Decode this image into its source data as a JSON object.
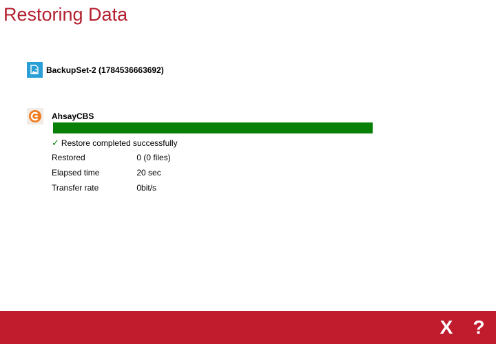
{
  "page": {
    "title": "Restoring Data"
  },
  "backup_set": {
    "name": "BackupSet-2 (1784536663692)",
    "icon": "backup-set-icon"
  },
  "destination": {
    "name": "AhsayCBS",
    "icon": "ahsay-cbs-icon",
    "progress_fraction": 1.0,
    "status": "Restore completed successfully",
    "stats": [
      {
        "label": "Restored",
        "value": "0 (0 files)"
      },
      {
        "label": "Elapsed time",
        "value": "20 sec"
      },
      {
        "label": "Transfer rate",
        "value": "0bit/s"
      }
    ]
  },
  "footer": {
    "close_label": "X",
    "help_label": "?"
  },
  "colors": {
    "accent": "#c01c2d",
    "title": "#b3202f",
    "progress": "#088008",
    "backup_icon_bg": "#2a9fd6",
    "cbs_icon": "#f07c22"
  }
}
